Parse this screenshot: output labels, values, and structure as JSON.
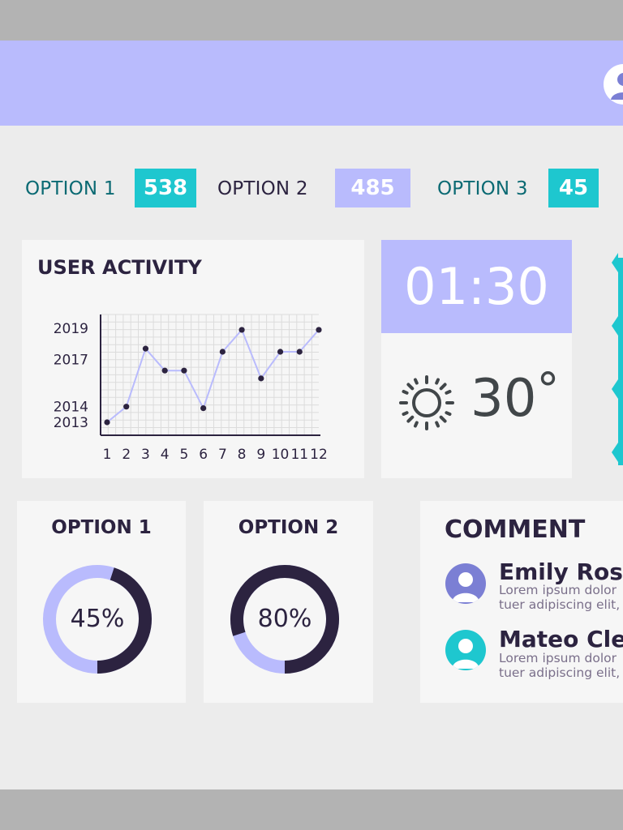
{
  "colors": {
    "teal": "#1ec7cf",
    "lavender": "#b9bbfd",
    "purple": "#7b7fd4",
    "dark": "#2c2340",
    "teal_text": "#0b6a73"
  },
  "header": {
    "avatar_icon": "user-avatar-icon"
  },
  "options": [
    {
      "label": "OPTION 1",
      "value": "538"
    },
    {
      "label": "OPTION 2",
      "value": "485"
    },
    {
      "label": "OPTION 3",
      "value": "45"
    }
  ],
  "activity": {
    "title": "USER ACTIVITY",
    "chart_data": {
      "type": "line",
      "title": "USER ACTIVITY",
      "x": [
        1,
        2,
        3,
        4,
        5,
        6,
        7,
        8,
        9,
        10,
        11,
        12
      ],
      "x_tick_labels": [
        "1",
        "2",
        "3",
        "4",
        "5",
        "6",
        "7",
        "8",
        "9",
        "10",
        "11",
        "12"
      ],
      "y_tick_labels": [
        "2013",
        "2014",
        "2017",
        "2019"
      ],
      "y": [
        2013,
        2014,
        2017.7,
        2016.3,
        2016.3,
        2013.9,
        2017.5,
        2018.9,
        2015.8,
        2017.5,
        2017.5,
        2018.9
      ],
      "ylim": [
        2013,
        2019
      ],
      "grid": true,
      "line_color": "#b9bbfd",
      "marker_color": "#2c2340"
    }
  },
  "clock": {
    "time": "01:30"
  },
  "weather": {
    "temperature": "30",
    "degree": "°",
    "icon": "sun-icon"
  },
  "donuts": [
    {
      "title": "OPTION 1",
      "label": "45%",
      "percent": 45
    },
    {
      "title": "OPTION 2",
      "label": "80%",
      "percent": 80
    }
  ],
  "comments": {
    "title": "COMMENT",
    "items": [
      {
        "name": "Emily Rose",
        "line1": "Lorem ipsum dolor",
        "line2": "tuer adipiscing elit,",
        "avatar_color": "#7b7fd4"
      },
      {
        "name": "Mateo Clea",
        "line1": "Lorem ipsum dolor",
        "line2": "tuer adipiscing elit,",
        "avatar_color": "#1ec7cf"
      }
    ]
  }
}
